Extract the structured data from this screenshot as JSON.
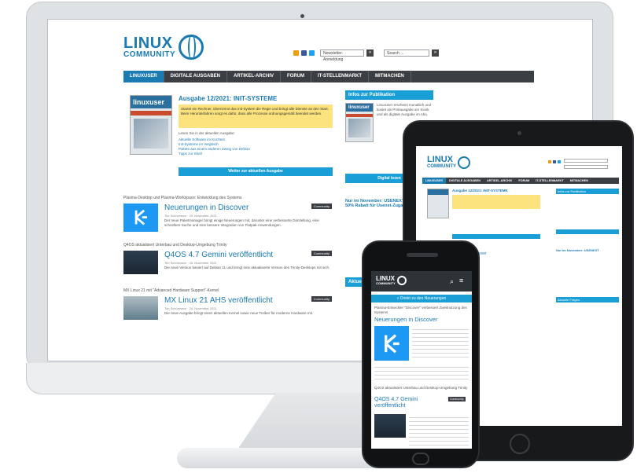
{
  "site": {
    "logo_line1": "LINUX",
    "logo_line2": "COMMUNITY",
    "newsletter_label": "Newsletter-Anmeldung",
    "search_placeholder": "Search ...",
    "go": "»",
    "nav": [
      "LINUXUSER",
      "DIGITALE AUSGABEN",
      "ARTIKEL-ARCHIV",
      "FORUM",
      "IT-STELLENMARKT",
      "MITMACHEN"
    ],
    "cover_brand": "linuxuser",
    "issue_title": "Ausgabe 12/2021: INIT-SYSTEME",
    "intro": "Startet ein Rechner, übernimmt das Init-System die Regie und bringt alle Dienste an den Start. Beim Herunterfahren sorgt es dafür, dass alle Prozesse ordnungsgemäß beendet werden.",
    "lesen_sie": "Lesen Sie in der aktuellen Ausgabe:",
    "bullets": [
      "Aktuelle Software im Kurztest",
      "Init-Systeme im Vergleich",
      "Pakete aus einem anderen Zweig von Debian",
      "Tipps zur Shell"
    ],
    "more_button": "Weiter zur aktuellen Ausgabe",
    "sidebar_title": "Infos zur Publikation",
    "sidebar_text": "LinuxUser erscheint monatlich und kostet als Printausgabe am Kiosk und als digitale Ausgabe im Abo.",
    "sidebar_btn": "Digital lesen",
    "sidebar2_title": "Nur im November: USENEXT",
    "sidebar2_sub": "50% Rabatt für Usenet-Zugang",
    "sidebar3_title": "Aktuelle Fragen",
    "articles": [
      {
        "kicker": "Plasma-Desktop und Plasma-Workspace: Entwicklung des Systems",
        "title": "Neuerungen in Discover",
        "meta": "Tim Schürmann · 29. November 2021",
        "text": "Der neue Paketmanager bringt einige Neuerungen mit, darunter eine verbesserte Darstellung, eine schnellere Suche und eine bessere Integration von Flatpak-Anwendungen.",
        "tag": "Community"
      },
      {
        "kicker": "Q4OS aktualisiert Unterbau und Desktop-Umgebung Trinity",
        "title": "Q4OS 4.7 Gemini veröffentlicht",
        "meta": "Tim Schürmann · 26. November 2021",
        "text": "Die neue Version basiert auf Debian 11 und bringt eine aktualisierte Version des Trinity-Desktops mit sich.",
        "tag": "Community"
      },
      {
        "kicker": "MX Linux 21 mit \"Advanced Hardware Support\"-Kernel",
        "title": "MX Linux 21 AHS veröffentlicht",
        "meta": "Tim Schürmann · 24. November 2021",
        "text": "Die neue Ausgabe bringt einen aktuellen Kernel sowie neue Treiber für moderne Hardware mit.",
        "tag": "Community"
      }
    ],
    "tablet_nav": [
      "LINUXUSER",
      "DIGITALE AUSGABEN",
      "ARTIKEL-ARCHIV",
      "FORUM",
      "IT-STELLENMARKT",
      "MITMACHEN"
    ],
    "phone_banner": "» Direkt zu den Neuerungen",
    "phone_article_kicker": "Plasma-Entwickler \"Discover\" verbessert Zweitnutzung des Systems",
    "phone_article1_title": "Neuerungen in Discover",
    "phone_article2_kicker": "Q4OS aktualisiert Unterbau und Desktop-Umgebung Trinity",
    "phone_article2_title": "Q4OS 4.7 Gemini veröffentlicht",
    "phone_tag": "Community"
  }
}
